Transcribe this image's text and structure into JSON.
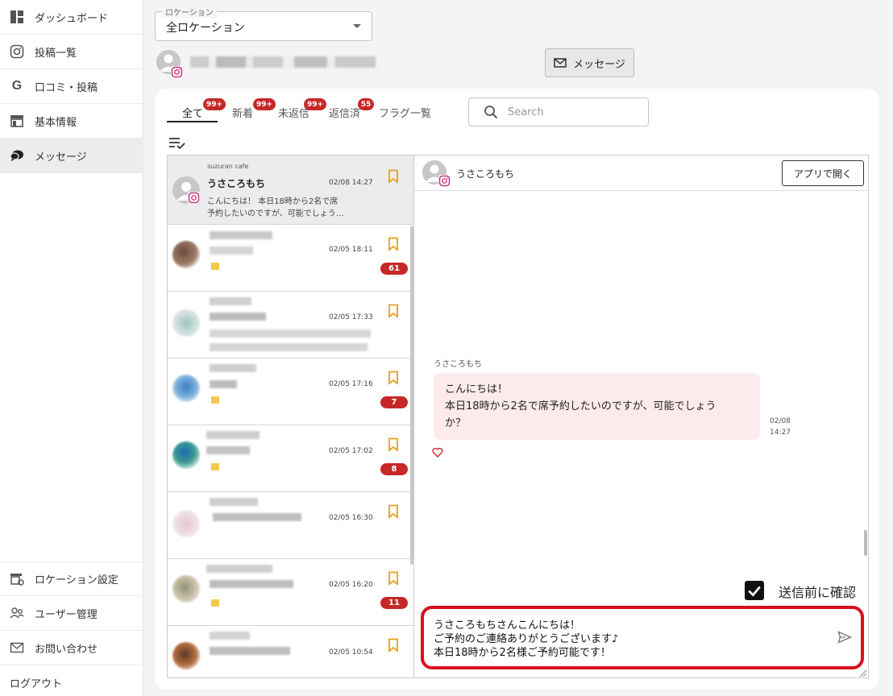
{
  "sidebar": {
    "items": [
      {
        "label": "ダッシュボード",
        "icon": "dashboard-icon"
      },
      {
        "label": "投稿一覧",
        "icon": "instagram-icon"
      },
      {
        "label": "口コミ・投稿",
        "icon": "google-icon"
      },
      {
        "label": "基本情報",
        "icon": "store-icon"
      },
      {
        "label": "メッセージ",
        "icon": "chat-bubbles-icon"
      }
    ],
    "bottom_items": [
      {
        "label": "ロケーション設定",
        "icon": "location-settings-icon"
      },
      {
        "label": "ユーザー管理",
        "icon": "users-icon"
      },
      {
        "label": "お問い合わせ",
        "icon": "mail-icon"
      },
      {
        "label": "ログアウト"
      }
    ]
  },
  "location": {
    "legend": "ロケーション",
    "value": "全ロケーション"
  },
  "header": {
    "message_button": "メッセージ"
  },
  "tabs": [
    {
      "label": "全て",
      "badge": "99+"
    },
    {
      "label": "新着",
      "badge": "99+"
    },
    {
      "label": "未返信",
      "badge": "99+"
    },
    {
      "label": "返信済",
      "badge": "55"
    },
    {
      "label": "フラグ一覧",
      "badge": ""
    }
  ],
  "search": {
    "placeholder": "Search"
  },
  "conversations": [
    {
      "account": "suzuran cafe",
      "name": "うさころもち",
      "time": "02/08 14:27",
      "preview1": "こんにちは！ 本日18時から2名で席",
      "preview2": "予約したいのですが、可能でしょう…",
      "count": ""
    },
    {
      "time": "02/05 18:11",
      "count": "61"
    },
    {
      "time": "02/05 17:33",
      "count": ""
    },
    {
      "time": "02/05 17:16",
      "count": "7"
    },
    {
      "time": "02/05 17:02",
      "count": "8"
    },
    {
      "time": "02/05 16:30",
      "count": ""
    },
    {
      "time": "02/05 16:20",
      "count": "11"
    },
    {
      "time": "02/05 10:54",
      "count": ""
    }
  ],
  "chat": {
    "name": "うさころもち",
    "open_app_button": "アプリで開く",
    "sender": "うさころもち",
    "message_lines": [
      "こんにちは！",
      "本日18時から2名で席予約したいのですが、可能でしょう",
      "か？"
    ],
    "message_date": "02/08",
    "message_time": "14:27",
    "confirm_label": "送信前に確認",
    "reply_lines": [
      "うさころもちさんこんにちは！",
      "ご予約のご連絡ありがとうございます♪",
      "本日18時から2名様ご予約可能です！"
    ]
  },
  "colors": {
    "badge": "#c62828",
    "bubble": "#fdeaec",
    "highlight": "#d8101e",
    "bookmark": "#e3a21a"
  }
}
